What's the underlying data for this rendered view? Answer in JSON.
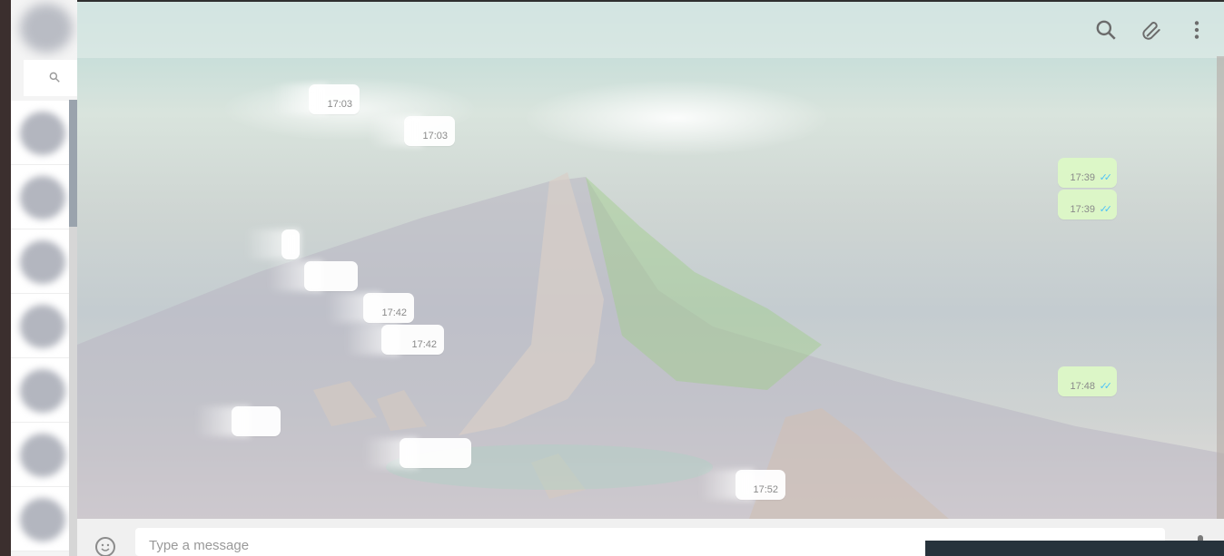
{
  "header": {
    "icons": [
      "search-icon",
      "attach-icon",
      "menu-icon"
    ]
  },
  "messages": [
    {
      "direction": "in",
      "time": "17:03"
    },
    {
      "direction": "in",
      "time": "17:03"
    },
    {
      "direction": "out",
      "time": "17:39",
      "status": "read"
    },
    {
      "direction": "out",
      "time": "17:39",
      "status": "read"
    },
    {
      "direction": "in",
      "time": "17:42"
    },
    {
      "direction": "in",
      "time": "17:42"
    },
    {
      "direction": "out",
      "time": "17:48",
      "status": "read"
    },
    {
      "direction": "in",
      "time": "17:52"
    }
  ],
  "composer": {
    "placeholder": "Type a message"
  },
  "colors": {
    "incoming_bubble": "#ffffff",
    "outgoing_bubble": "#dcf8c6",
    "read_ticks": "#4fc3f7",
    "footer": "#f0f0f0"
  }
}
